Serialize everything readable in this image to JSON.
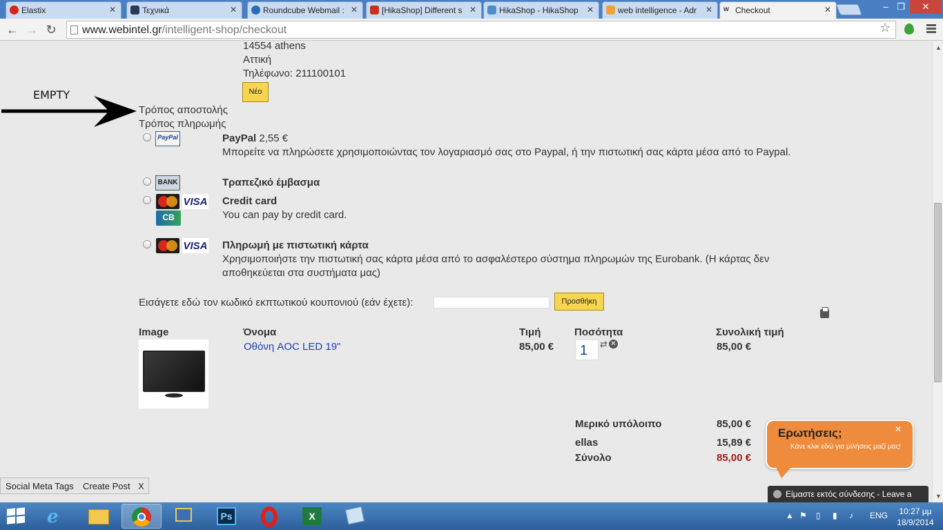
{
  "browser": {
    "tabs": [
      {
        "label": "Elastix",
        "favicon_color": "#d9261c"
      },
      {
        "label": "Τεχνικά",
        "favicon_color": "#2b3a5a"
      },
      {
        "label": "Roundcube Webmail :",
        "favicon_color": "#2b6db5"
      },
      {
        "label": "[HikaShop] Different s",
        "favicon_color": "#c8321e"
      },
      {
        "label": "HikaShop - HikaShop",
        "favicon_color": "#4b8ec9"
      },
      {
        "label": "web intelligence - Adr",
        "favicon_color": "#f0a13c"
      },
      {
        "label": "Checkout",
        "favicon_color": "#333"
      }
    ],
    "url_host": "www.webintel.gr",
    "url_path": "/intelligent-shop/checkout"
  },
  "address": {
    "line_city": "14554 athens",
    "line_region": "Αττική",
    "line_phone": "Τηλέφωνο: 211100101",
    "new_button": "Νέο"
  },
  "annotation": {
    "text": "EMPTY"
  },
  "shipping": {
    "label": "Τρόπος αποστολής"
  },
  "payment": {
    "label": "Τρόπος πληρωμής",
    "methods": [
      {
        "name": "PayPal",
        "price": "2,55 €",
        "description": "Μπορείτε να πληρώσετε χρησιμοποιώντας τον λογαριασμό σας στο Paypal, ή την πιστωτική σας κάρτα μέσα από το Paypal."
      },
      {
        "name": "Τραπεζικό έμβασμα"
      },
      {
        "name": "Credit card",
        "description": "You can pay by credit card."
      },
      {
        "name": "Πληρωμή με πιστωτική κάρτα",
        "description": "Χρησιμοποιήστε την πιστωτική σας κάρτα μέσα από το ασφαλέστερο σύστημα πληρωμών της Eurobank. (Η κάρτας δεν αποθηκεύεται στα συστήματα μας)"
      }
    ],
    "logos": {
      "paypal": "PayPal",
      "bank": "BANK",
      "visa": "VISA",
      "cb": "CB"
    }
  },
  "coupon": {
    "label": "Εισάγετε εδώ τον κωδικό εκπτωτικού κουπονιού (εάν έχετε):",
    "value": "",
    "button": "Προσθήκη"
  },
  "cart": {
    "headers": {
      "image": "Image",
      "name": "Όνομα",
      "price": "Τιμή",
      "quantity": "Ποσότητα",
      "total": "Συνολική τιμή"
    },
    "items": [
      {
        "name": "Οθόνη AOC LED 19\"",
        "price": "85,00 €",
        "quantity": "1",
        "total": "85,00 €"
      }
    ],
    "summary": {
      "subtotal_label": "Μερικό υπόλοιπο",
      "subtotal_value": "85,00 €",
      "shipping_label": "ellas",
      "shipping_value": "15,89 €",
      "total_label": "Σύνολο",
      "total_value": "85,00 €"
    }
  },
  "chat": {
    "title": "Ερωτήσεις;",
    "subtitle": "Κάνε κλικ εδώ για μιλήσεις μαζί μας!",
    "status_bar": "Είμαστε εκτός σύνδεσης - Leave a"
  },
  "social_bar": {
    "meta": "Social Meta Tags",
    "create": "Create Post",
    "close": "X"
  },
  "taskbar": {
    "language": "ENG",
    "time": "10:27 μμ",
    "date": "18/9/2014"
  }
}
